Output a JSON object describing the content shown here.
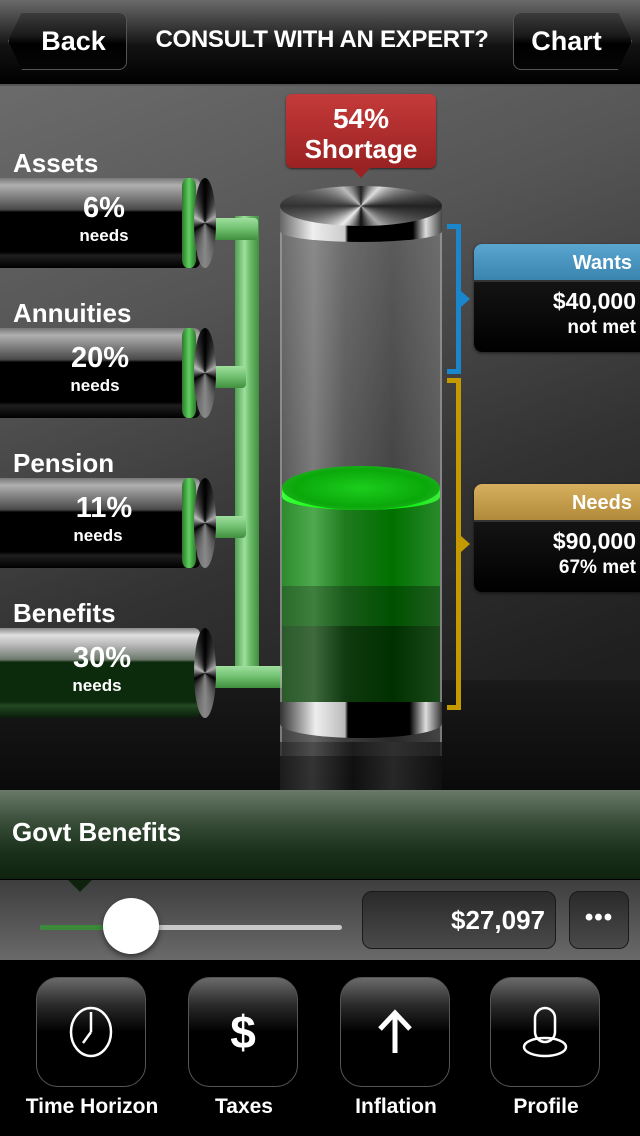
{
  "nav": {
    "back_label": "Back",
    "title": "CONSULT WITH AN EXPERT?",
    "chart_label": "Chart"
  },
  "sources": [
    {
      "label": "Assets",
      "percent": "6%",
      "sub": "needs",
      "selected": false
    },
    {
      "label": "Annuities",
      "percent": "20%",
      "sub": "needs",
      "selected": false
    },
    {
      "label": "Pension",
      "percent": "11%",
      "sub": "needs",
      "selected": false
    },
    {
      "label": "Benefits",
      "percent": "30%",
      "sub": "needs",
      "selected": true
    }
  ],
  "shortage": {
    "percent": "54%",
    "label": "Shortage"
  },
  "wants": {
    "title": "Wants",
    "amount": "$40,000",
    "status": "not met",
    "color": "#1a86cc"
  },
  "needs": {
    "title": "Needs",
    "amount": "$90,000",
    "status": "67% met",
    "color": "#c49a00"
  },
  "detail": {
    "title": "Govt Benefits",
    "slider_fraction": 0.3,
    "value": "$27,097",
    "more_label": "•••"
  },
  "toolbar": {
    "items": [
      {
        "label": "Time Horizon",
        "icon": "clock-icon"
      },
      {
        "label": "Taxes",
        "icon": "dollar-icon",
        "glyph": "$"
      },
      {
        "label": "Inflation",
        "icon": "arrow-up-icon"
      },
      {
        "label": "Profile",
        "icon": "person-icon"
      }
    ]
  },
  "colors": {
    "shortage_red": "#b02e2e",
    "liquid_green": "#00ff00",
    "pipe_green": "#7fcf7f"
  }
}
